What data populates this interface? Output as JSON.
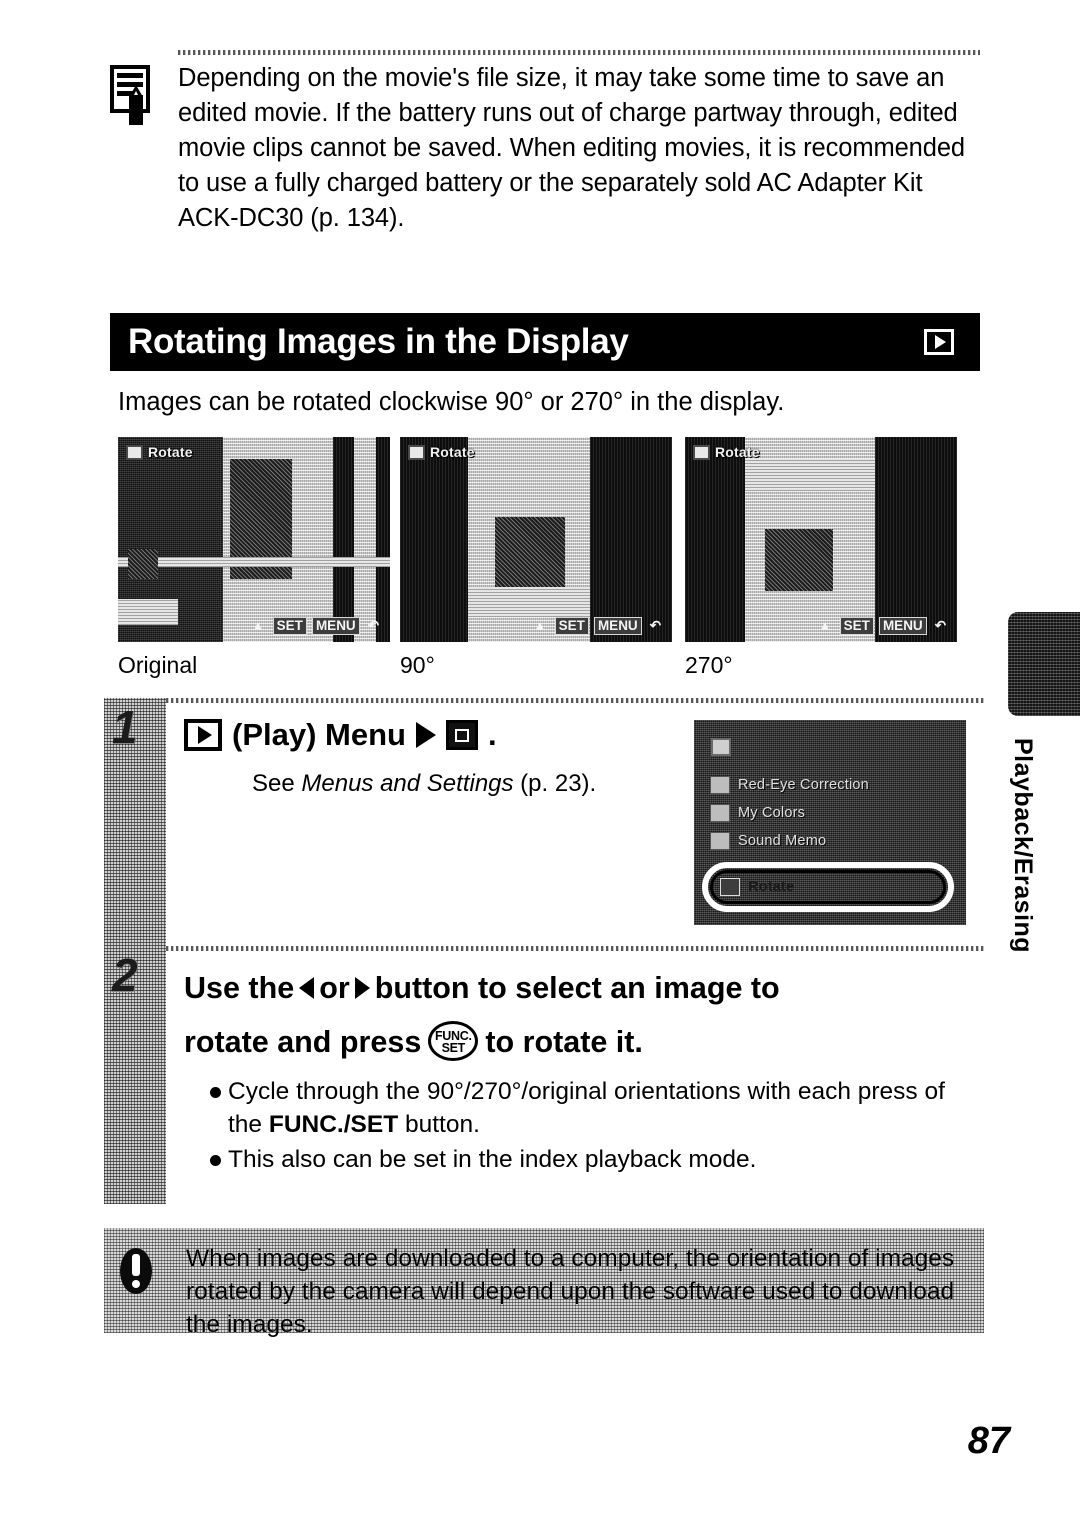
{
  "note": {
    "icon": "memo-pencil-icon",
    "text": "Depending on the movie's file size, it may take some time to save an edited movie. If the battery runs out of charge partway through, edited movie clips cannot be saved. When editing movies, it is recommended to use a fully charged battery or the separately sold AC Adapter Kit ACK-DC30 (p. 134)."
  },
  "section": {
    "title": "Rotating Images in the Display",
    "badge_icon": "play-mode-icon"
  },
  "intro": "Images can be rotated clockwise 90° or 270° in the display.",
  "thumbnails": [
    {
      "caption": "Original",
      "screen_tag": "Rotate",
      "footer_keys": [
        "SET",
        "MENU"
      ],
      "orientation": "original"
    },
    {
      "caption": "90°",
      "screen_tag": "Rotate",
      "footer_keys": [
        "SET",
        "MENU"
      ],
      "orientation": "90"
    },
    {
      "caption": "270°",
      "screen_tag": "Rotate",
      "footer_keys": [
        "SET",
        "MENU"
      ],
      "orientation": "270"
    }
  ],
  "steps": [
    {
      "number": "1",
      "heading_play_label": "(Play) Menu",
      "heading_period": ".",
      "sub_prefix": "See ",
      "sub_italic": "Menus and Settings",
      "sub_suffix": " (p. 23).",
      "menu_screen": {
        "items": [
          "Red-Eye Correction",
          "My Colors",
          "Sound Memo"
        ],
        "highlighted_item": "Rotate"
      }
    },
    {
      "number": "2",
      "heading_part1": "Use the",
      "heading_part2": "or",
      "heading_part3": "button to select an image to",
      "heading_part4": "rotate and press",
      "heading_part5": "to rotate it.",
      "func_set_top": "FUNC.",
      "func_set_bottom": "SET",
      "bullets": [
        {
          "pre": "Cycle through the 90°/270°/original orientations with each press of the ",
          "bold": "FUNC./SET",
          "post": " button."
        },
        {
          "pre": "This also can be set in the index playback mode.",
          "bold": "",
          "post": ""
        }
      ]
    }
  ],
  "caution": {
    "icon": "exclamation-icon",
    "text": "When images are downloaded to a computer, the orientation of images rotated by the camera will depend upon the software used to download the images."
  },
  "side_tab": {
    "label": "Playback/Erasing"
  },
  "page_number": "87",
  "colors": {
    "ink": "#000000",
    "paper": "#ffffff",
    "header_bar": "#000000",
    "header_text": "#ffffff",
    "caution_band": "#cfcfcf",
    "side_tab_block": "#2e2e2e"
  }
}
